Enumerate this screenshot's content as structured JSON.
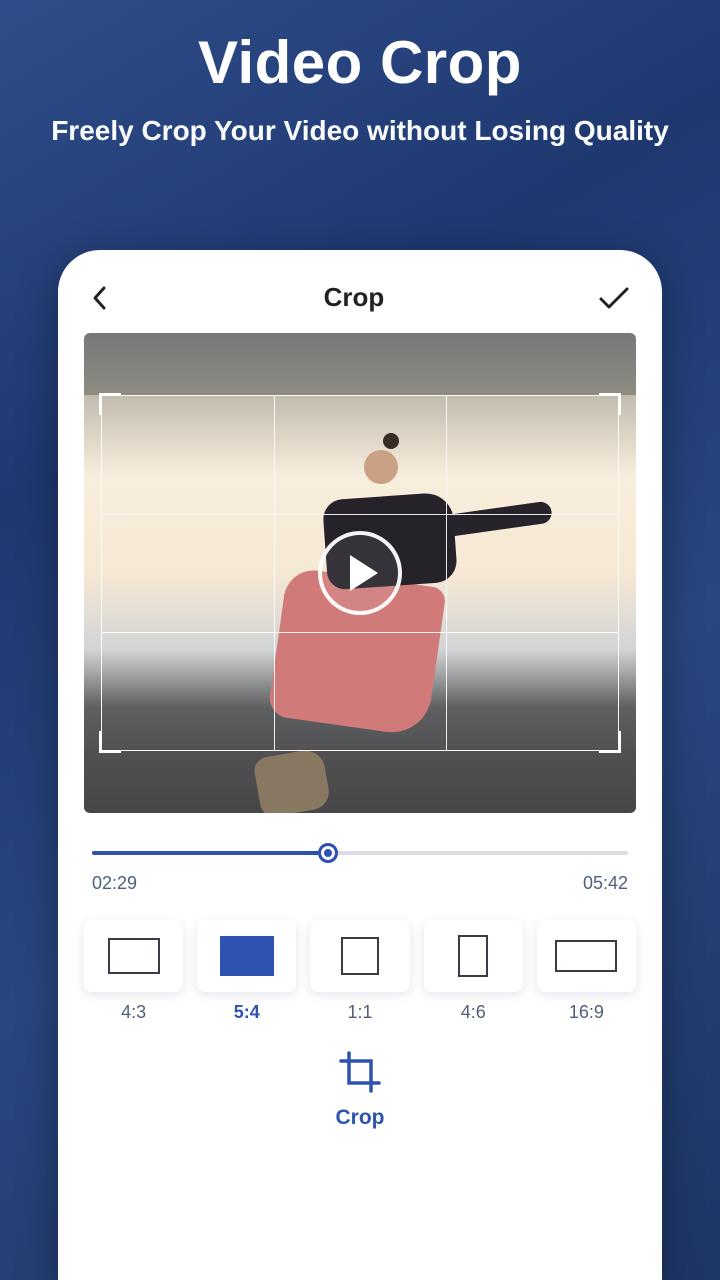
{
  "hero": {
    "title": "Video Crop",
    "subtitle": "Freely Crop Your Video without Losing Quality"
  },
  "topbar": {
    "title": "Crop"
  },
  "playback": {
    "current": "02:29",
    "total": "05:42",
    "progress_pct": 44
  },
  "ratios": [
    {
      "label": "4:3",
      "shape_class": "r-43",
      "selected": false
    },
    {
      "label": "5:4",
      "shape_class": "r-54",
      "selected": true
    },
    {
      "label": "1:1",
      "shape_class": "r-11",
      "selected": false
    },
    {
      "label": "4:6",
      "shape_class": "r-46",
      "selected": false
    },
    {
      "label": "16:9",
      "shape_class": "r-169",
      "selected": false
    }
  ],
  "action": {
    "label": "Crop"
  },
  "colors": {
    "accent": "#2e52b0"
  }
}
